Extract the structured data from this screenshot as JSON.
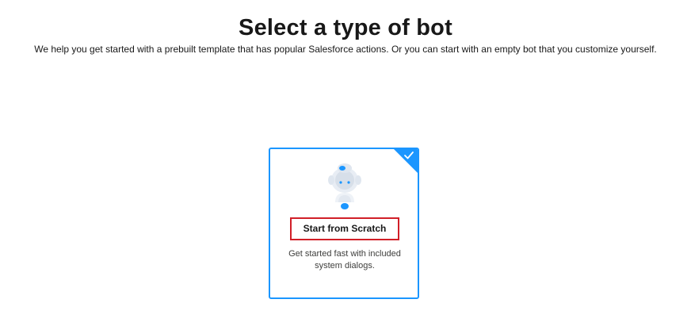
{
  "header": {
    "title": "Select a type of bot",
    "subtitle": "We help you get started with a prebuilt template that has popular Salesforce actions. Or you can start with an empty bot that you customize yourself."
  },
  "options": [
    {
      "title": "Start from Scratch",
      "description": "Get started fast with included system dialogs.",
      "selected": true,
      "icon": "bot-icon"
    }
  ],
  "colors": {
    "accent": "#1b96ff",
    "highlight_border": "#d11f28"
  }
}
